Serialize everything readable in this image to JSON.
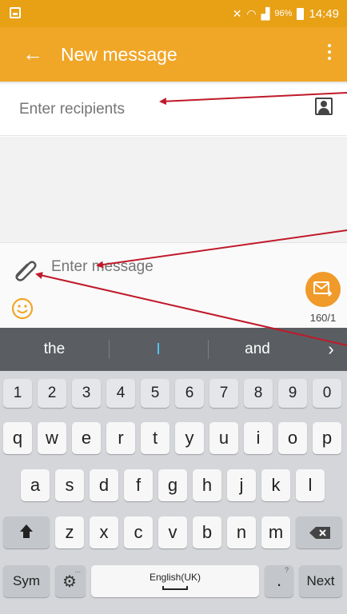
{
  "status_bar": {
    "battery": "96%",
    "time": "14:49"
  },
  "app_bar": {
    "back_icon": "←",
    "title": "New message"
  },
  "recipients": {
    "placeholder": "Enter recipients"
  },
  "compose": {
    "placeholder": "Enter message",
    "counter": "160/1"
  },
  "keyboard": {
    "suggestions": [
      "the",
      "I",
      "and"
    ],
    "suggestion_next": "›",
    "number_row": [
      "1",
      "2",
      "3",
      "4",
      "5",
      "6",
      "7",
      "8",
      "9",
      "0"
    ],
    "row1": [
      "q",
      "w",
      "e",
      "r",
      "t",
      "y",
      "u",
      "i",
      "o",
      "p"
    ],
    "row2": [
      "a",
      "s",
      "d",
      "f",
      "g",
      "h",
      "j",
      "k",
      "l"
    ],
    "row3": [
      "z",
      "x",
      "c",
      "v",
      "b",
      "n",
      "m"
    ],
    "sym": "Sym",
    "space_label": "English(UK)",
    "period": ".",
    "next": "Next",
    "settings_superscript": "...",
    "period_superscript": "?"
  },
  "colors": {
    "app_bar": "#f0a627",
    "status_bar": "#e8a015",
    "send_button": "#f09a2a",
    "annotation_arrow": "#c0192a"
  }
}
